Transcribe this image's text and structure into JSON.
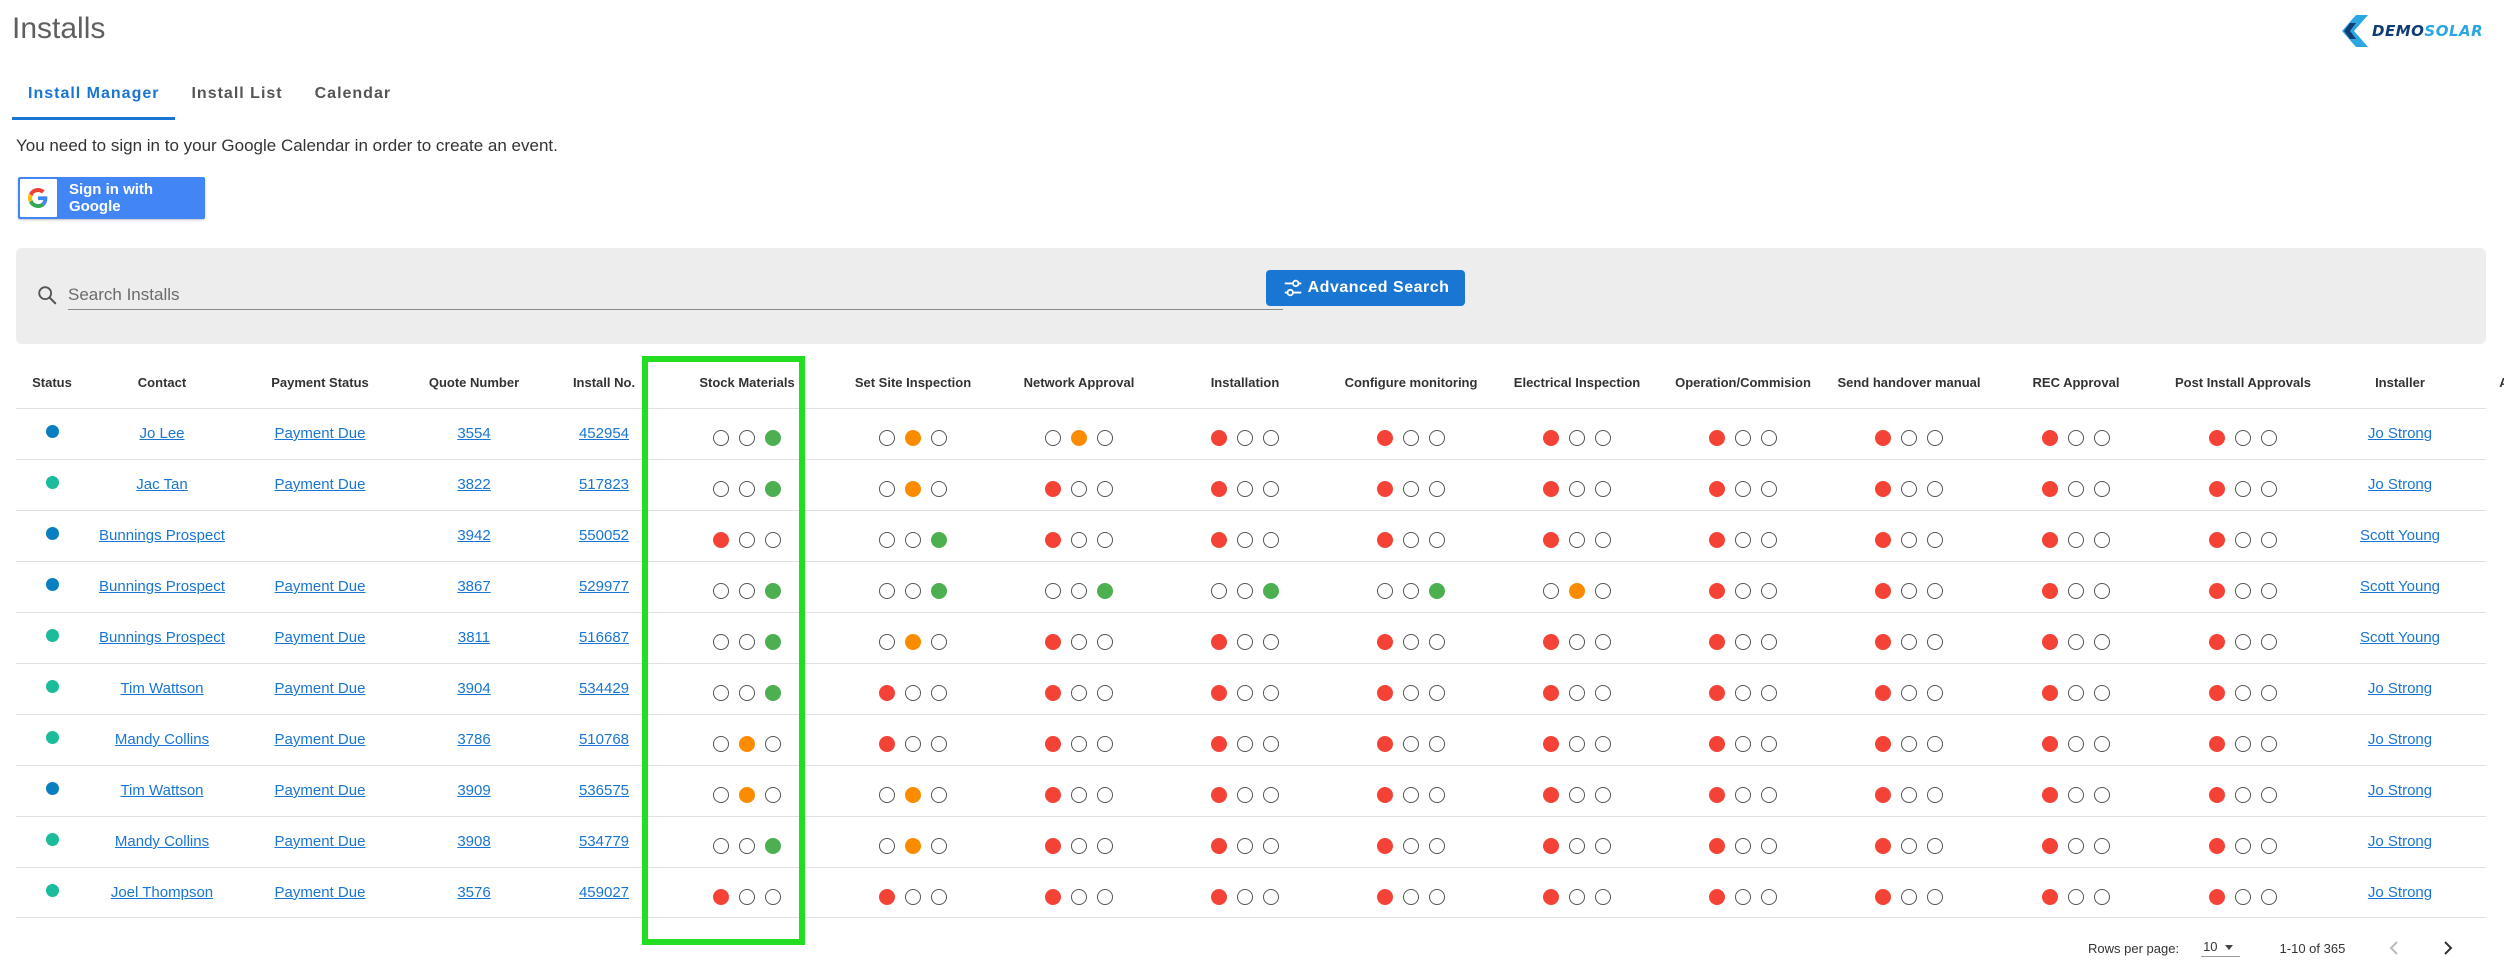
{
  "page": {
    "title": "Installs"
  },
  "logo": {
    "part1": "DEMO",
    "part2": "SOLAR"
  },
  "tabs": [
    {
      "label": "Install Manager",
      "active": true
    },
    {
      "label": "Install List",
      "active": false
    },
    {
      "label": "Calendar",
      "active": false
    }
  ],
  "notice": "You need to sign in to your Google Calendar in order to create an event.",
  "google_button": {
    "label": "Sign in with Google"
  },
  "search": {
    "placeholder": "Search Installs",
    "value": "",
    "advanced_label": "Advanced Search"
  },
  "table": {
    "headers": [
      "Status",
      "Contact",
      "Payment Status",
      "Quote Number",
      "Install No.",
      "Stock Materials",
      "Set Site Inspection",
      "Network Approval",
      "Installation",
      "Configure monitoring",
      "Electrical Inspection",
      "Operation/Commision",
      "Send handover manual",
      "REC Approval",
      "Post Install Approvals",
      "Installer",
      "Action"
    ],
    "highlighted_column": "Stock Materials",
    "colors": {
      "status_blue": "#0a7fc0",
      "status_teal": "#1bbc9b",
      "red": "#f44336",
      "orange": "#fb8c00",
      "green": "#4caf50",
      "link": "#1976d2",
      "highlight": "#22dd22"
    },
    "rows": [
      {
        "status": "blue",
        "contact": "Jo Lee",
        "payment": "Payment Due",
        "quote": "3554",
        "install_no": "452954",
        "stages": [
          [
            "off",
            "off",
            "green"
          ],
          [
            "off",
            "orange",
            "off"
          ],
          [
            "off",
            "orange",
            "off"
          ],
          [
            "red",
            "off",
            "off"
          ],
          [
            "red",
            "off",
            "off"
          ],
          [
            "red",
            "off",
            "off"
          ],
          [
            "red",
            "off",
            "off"
          ],
          [
            "red",
            "off",
            "off"
          ],
          [
            "red",
            "off",
            "off"
          ],
          [
            "red",
            "off",
            "off"
          ]
        ],
        "installer": "Jo Strong"
      },
      {
        "status": "teal",
        "contact": "Jac Tan",
        "payment": "Payment Due",
        "quote": "3822",
        "install_no": "517823",
        "stages": [
          [
            "off",
            "off",
            "green"
          ],
          [
            "off",
            "orange",
            "off"
          ],
          [
            "red",
            "off",
            "off"
          ],
          [
            "red",
            "off",
            "off"
          ],
          [
            "red",
            "off",
            "off"
          ],
          [
            "red",
            "off",
            "off"
          ],
          [
            "red",
            "off",
            "off"
          ],
          [
            "red",
            "off",
            "off"
          ],
          [
            "red",
            "off",
            "off"
          ],
          [
            "red",
            "off",
            "off"
          ]
        ],
        "installer": "Jo Strong"
      },
      {
        "status": "blue",
        "contact": "Bunnings Prospect",
        "payment": "",
        "quote": "3942",
        "install_no": "550052",
        "stages": [
          [
            "red",
            "off",
            "off"
          ],
          [
            "off",
            "off",
            "green"
          ],
          [
            "red",
            "off",
            "off"
          ],
          [
            "red",
            "off",
            "off"
          ],
          [
            "red",
            "off",
            "off"
          ],
          [
            "red",
            "off",
            "off"
          ],
          [
            "red",
            "off",
            "off"
          ],
          [
            "red",
            "off",
            "off"
          ],
          [
            "red",
            "off",
            "off"
          ],
          [
            "red",
            "off",
            "off"
          ]
        ],
        "installer": "Scott Young"
      },
      {
        "status": "blue",
        "contact": "Bunnings Prospect",
        "payment": "Payment Due",
        "quote": "3867",
        "install_no": "529977",
        "stages": [
          [
            "off",
            "off",
            "green"
          ],
          [
            "off",
            "off",
            "green"
          ],
          [
            "off",
            "off",
            "green"
          ],
          [
            "off",
            "off",
            "green"
          ],
          [
            "off",
            "off",
            "green"
          ],
          [
            "off",
            "orange",
            "off"
          ],
          [
            "red",
            "off",
            "off"
          ],
          [
            "red",
            "off",
            "off"
          ],
          [
            "red",
            "off",
            "off"
          ],
          [
            "red",
            "off",
            "off"
          ]
        ],
        "installer": "Scott Young"
      },
      {
        "status": "teal",
        "contact": "Bunnings Prospect",
        "payment": "Payment Due",
        "quote": "3811",
        "install_no": "516687",
        "stages": [
          [
            "off",
            "off",
            "green"
          ],
          [
            "off",
            "orange",
            "off"
          ],
          [
            "red",
            "off",
            "off"
          ],
          [
            "red",
            "off",
            "off"
          ],
          [
            "red",
            "off",
            "off"
          ],
          [
            "red",
            "off",
            "off"
          ],
          [
            "red",
            "off",
            "off"
          ],
          [
            "red",
            "off",
            "off"
          ],
          [
            "red",
            "off",
            "off"
          ],
          [
            "red",
            "off",
            "off"
          ]
        ],
        "installer": "Scott Young"
      },
      {
        "status": "teal",
        "contact": "Tim Wattson",
        "payment": "Payment Due",
        "quote": "3904",
        "install_no": "534429",
        "stages": [
          [
            "off",
            "off",
            "green"
          ],
          [
            "red",
            "off",
            "off"
          ],
          [
            "red",
            "off",
            "off"
          ],
          [
            "red",
            "off",
            "off"
          ],
          [
            "red",
            "off",
            "off"
          ],
          [
            "red",
            "off",
            "off"
          ],
          [
            "red",
            "off",
            "off"
          ],
          [
            "red",
            "off",
            "off"
          ],
          [
            "red",
            "off",
            "off"
          ],
          [
            "red",
            "off",
            "off"
          ]
        ],
        "installer": "Jo Strong"
      },
      {
        "status": "teal",
        "contact": "Mandy Collins",
        "payment": "Payment Due",
        "quote": "3786",
        "install_no": "510768",
        "stages": [
          [
            "off",
            "orange",
            "off"
          ],
          [
            "red",
            "off",
            "off"
          ],
          [
            "red",
            "off",
            "off"
          ],
          [
            "red",
            "off",
            "off"
          ],
          [
            "red",
            "off",
            "off"
          ],
          [
            "red",
            "off",
            "off"
          ],
          [
            "red",
            "off",
            "off"
          ],
          [
            "red",
            "off",
            "off"
          ],
          [
            "red",
            "off",
            "off"
          ],
          [
            "red",
            "off",
            "off"
          ]
        ],
        "installer": "Jo Strong"
      },
      {
        "status": "blue",
        "contact": "Tim Wattson",
        "payment": "Payment Due",
        "quote": "3909",
        "install_no": "536575",
        "stages": [
          [
            "off",
            "orange",
            "off"
          ],
          [
            "off",
            "orange",
            "off"
          ],
          [
            "red",
            "off",
            "off"
          ],
          [
            "red",
            "off",
            "off"
          ],
          [
            "red",
            "off",
            "off"
          ],
          [
            "red",
            "off",
            "off"
          ],
          [
            "red",
            "off",
            "off"
          ],
          [
            "red",
            "off",
            "off"
          ],
          [
            "red",
            "off",
            "off"
          ],
          [
            "red",
            "off",
            "off"
          ]
        ],
        "installer": "Jo Strong"
      },
      {
        "status": "teal",
        "contact": "Mandy Collins",
        "payment": "Payment Due",
        "quote": "3908",
        "install_no": "534779",
        "stages": [
          [
            "off",
            "off",
            "green"
          ],
          [
            "off",
            "orange",
            "off"
          ],
          [
            "red",
            "off",
            "off"
          ],
          [
            "red",
            "off",
            "off"
          ],
          [
            "red",
            "off",
            "off"
          ],
          [
            "red",
            "off",
            "off"
          ],
          [
            "red",
            "off",
            "off"
          ],
          [
            "red",
            "off",
            "off"
          ],
          [
            "red",
            "off",
            "off"
          ],
          [
            "red",
            "off",
            "off"
          ]
        ],
        "installer": "Jo Strong"
      },
      {
        "status": "teal",
        "contact": "Joel Thompson",
        "payment": "Payment Due",
        "quote": "3576",
        "install_no": "459027",
        "stages": [
          [
            "red",
            "off",
            "off"
          ],
          [
            "red",
            "off",
            "off"
          ],
          [
            "red",
            "off",
            "off"
          ],
          [
            "red",
            "off",
            "off"
          ],
          [
            "red",
            "off",
            "off"
          ],
          [
            "red",
            "off",
            "off"
          ],
          [
            "red",
            "off",
            "off"
          ],
          [
            "red",
            "off",
            "off"
          ],
          [
            "red",
            "off",
            "off"
          ],
          [
            "red",
            "off",
            "off"
          ]
        ],
        "installer": "Jo Strong"
      }
    ]
  },
  "pagination": {
    "rows_per_page_label": "Rows per page:",
    "rows_per_page": "10",
    "range": "1-10 of 365"
  },
  "icons": {
    "search": "search-icon",
    "advanced": "tune-icon",
    "view": "eye-icon",
    "prev": "chevron-left-icon",
    "next": "chevron-right-icon",
    "dropdown": "caret-down-icon"
  }
}
